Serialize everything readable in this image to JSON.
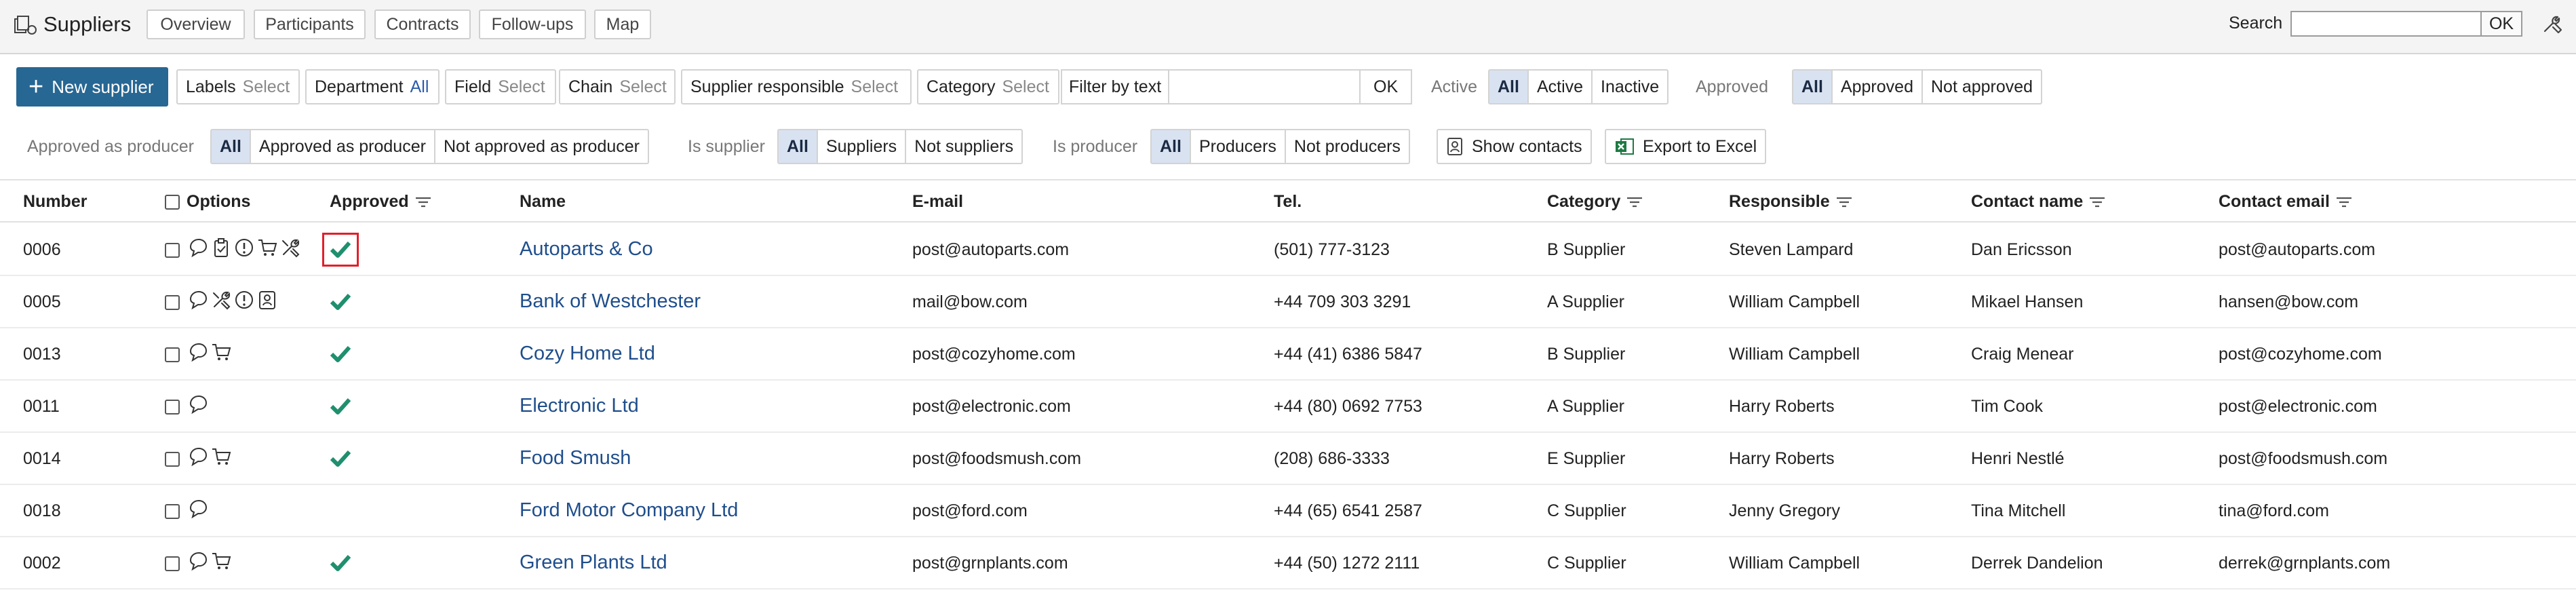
{
  "app": {
    "title": "Suppliers"
  },
  "tabs": [
    {
      "label": "Overview",
      "active": true
    },
    {
      "label": "Participants",
      "active": false
    },
    {
      "label": "Contracts",
      "active": false
    },
    {
      "label": "Follow-ups",
      "active": false
    },
    {
      "label": "Map",
      "active": false
    }
  ],
  "search": {
    "label": "Search",
    "value": "",
    "ok": "OK"
  },
  "toolbar": {
    "new_supplier": "New supplier",
    "filters": [
      {
        "label": "Labels",
        "value": "Select"
      },
      {
        "label": "Department",
        "value": "All"
      },
      {
        "label": "Field",
        "value": "Select"
      },
      {
        "label": "Chain",
        "value": "Select"
      },
      {
        "label": "Supplier responsible",
        "value": "Select"
      },
      {
        "label": "Category",
        "value": "Select"
      }
    ],
    "filter_text": {
      "label": "Filter by text",
      "value": "",
      "ok": "OK"
    },
    "active_group": {
      "label": "Active",
      "options": [
        "All",
        "Active",
        "Inactive"
      ],
      "selected": "All"
    },
    "approved_group": {
      "label": "Approved",
      "options": [
        "All",
        "Approved",
        "Not approved"
      ],
      "selected": "All"
    },
    "producer_approval_group": {
      "label": "Approved as producer",
      "options": [
        "All",
        "Approved as producer",
        "Not approved as producer"
      ],
      "selected": "All"
    },
    "supplier_group": {
      "label": "Is supplier",
      "options": [
        "All",
        "Suppliers",
        "Not suppliers"
      ],
      "selected": "All"
    },
    "producer_group": {
      "label": "Is producer",
      "options": [
        "All",
        "Producers",
        "Not producers"
      ],
      "selected": "All"
    },
    "show_contacts": "Show contacts",
    "export_excel": "Export to Excel"
  },
  "table": {
    "columns": [
      "Number",
      "Options",
      "Approved",
      "Name",
      "E-mail",
      "Tel.",
      "Category",
      "Responsible",
      "Contact name",
      "Contact email"
    ],
    "rows": [
      {
        "number": "0006",
        "icons": [
          "chat-icon",
          "clipboard-icon",
          "alert-icon",
          "cart-icon",
          "tools-icon"
        ],
        "approved": true,
        "highlight": true,
        "name": "Autoparts & Co",
        "email": "post@autoparts.com",
        "tel": "(501) 777-3123",
        "category": "B Supplier",
        "responsible": "Steven Lampard",
        "contact_name": "Dan Ericsson",
        "contact_email": "post@autoparts.com"
      },
      {
        "number": "0005",
        "icons": [
          "chat-icon",
          "tools-icon",
          "alert-icon",
          "badge-icon"
        ],
        "approved": true,
        "highlight": false,
        "name": "Bank of Westchester",
        "email": "mail@bow.com",
        "tel": "+44 709 303 3291",
        "category": "A Supplier",
        "responsible": "William Campbell",
        "contact_name": "Mikael Hansen",
        "contact_email": "hansen@bow.com"
      },
      {
        "number": "0013",
        "icons": [
          "chat-icon",
          "cart-icon"
        ],
        "approved": true,
        "highlight": false,
        "name": "Cozy Home Ltd",
        "email": "post@cozyhome.com",
        "tel": "+44 (41) 6386 5847",
        "category": "B Supplier",
        "responsible": "William Campbell",
        "contact_name": "Craig Menear",
        "contact_email": "post@cozyhome.com"
      },
      {
        "number": "0011",
        "icons": [
          "chat-icon"
        ],
        "approved": true,
        "highlight": false,
        "name": "Electronic Ltd",
        "email": "post@electronic.com",
        "tel": "+44 (80) 0692 7753",
        "category": "A Supplier",
        "responsible": "Harry Roberts",
        "contact_name": "Tim Cook",
        "contact_email": "post@electronic.com"
      },
      {
        "number": "0014",
        "icons": [
          "chat-icon",
          "cart-icon"
        ],
        "approved": true,
        "highlight": false,
        "name": "Food Smush",
        "email": "post@foodsmush.com",
        "tel": "(208) 686-3333",
        "category": "E Supplier",
        "responsible": "Harry Roberts",
        "contact_name": "Henri Nestlé",
        "contact_email": "post@foodsmush.com"
      },
      {
        "number": "0018",
        "icons": [
          "chat-icon"
        ],
        "approved": false,
        "highlight": false,
        "name": "Ford Motor Company Ltd",
        "email": "post@ford.com",
        "tel": "+44 (65) 6541 2587",
        "category": "C Supplier",
        "responsible": "Jenny Gregory",
        "contact_name": "Tina Mitchell",
        "contact_email": "tina@ford.com"
      },
      {
        "number": "0002",
        "icons": [
          "chat-icon",
          "cart-icon"
        ],
        "approved": true,
        "highlight": false,
        "name": "Green Plants Ltd",
        "email": "post@grnplants.com",
        "tel": "+44 (50) 1272 2111",
        "category": "C Supplier",
        "responsible": "William Campbell",
        "contact_name": "Derrek Dandelion",
        "contact_email": "derrek@grnplants.com"
      }
    ]
  },
  "colors": {
    "primary": "#276793",
    "approved_check": "#1f8f6e",
    "link": "#1f4e8c",
    "highlight": "#e0202a",
    "selected_segment": "#d9e2f0"
  }
}
